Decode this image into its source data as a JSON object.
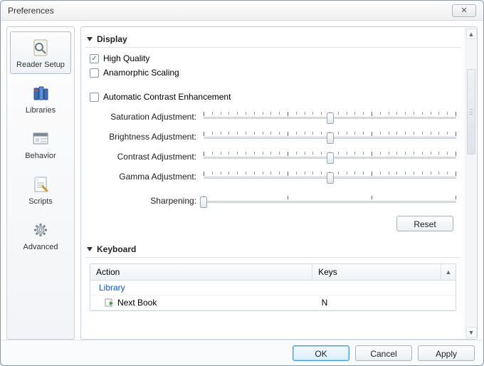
{
  "window": {
    "title": "Preferences"
  },
  "sidebar": {
    "items": [
      {
        "label": "Reader Setup",
        "selected": true
      },
      {
        "label": "Libraries",
        "selected": false
      },
      {
        "label": "Behavior",
        "selected": false
      },
      {
        "label": "Scripts",
        "selected": false
      },
      {
        "label": "Advanced",
        "selected": false
      }
    ]
  },
  "sections": {
    "display": {
      "title": "Display",
      "high_quality_label": "High Quality",
      "high_quality_checked": true,
      "anamorphic_label": "Anamorphic Scaling",
      "anamorphic_checked": false,
      "auto_contrast_label": "Automatic Contrast Enhancement",
      "auto_contrast_checked": false,
      "sliders": {
        "saturation": {
          "label": "Saturation Adjustment:",
          "pos": 50
        },
        "brightness": {
          "label": "Brightness Adjustment:",
          "pos": 50
        },
        "contrast": {
          "label": "Contrast Adjustment:",
          "pos": 50
        },
        "gamma": {
          "label": "Gamma Adjustment:",
          "pos": 50
        },
        "sharpening": {
          "label": "Sharpening:",
          "pos": 0
        }
      },
      "reset_label": "Reset"
    },
    "keyboard": {
      "title": "Keyboard",
      "columns": {
        "action": "Action",
        "keys": "Keys"
      },
      "group": "Library",
      "rows": [
        {
          "action": "Next Book",
          "keys": "N"
        }
      ]
    }
  },
  "footer": {
    "ok": "OK",
    "cancel": "Cancel",
    "apply": "Apply"
  }
}
